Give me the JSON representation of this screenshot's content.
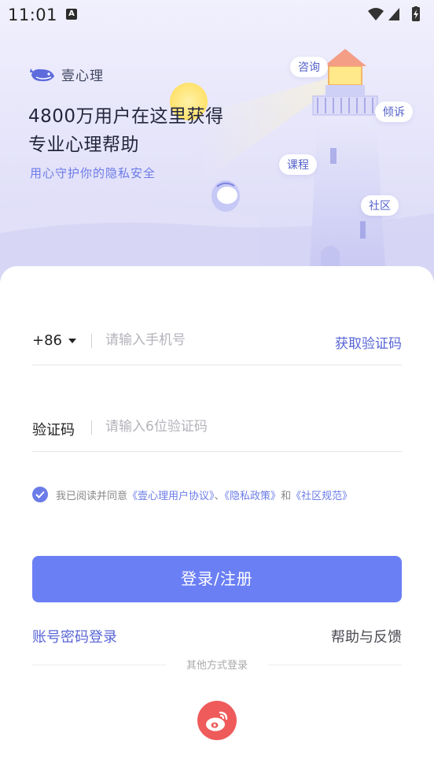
{
  "status_bar": {
    "time": "11:01",
    "notification_glyph": "A"
  },
  "brand": {
    "name": "壹心理",
    "logo_icon": "whale-logo-icon"
  },
  "hero": {
    "headline_line1": "4800万用户在这里获得",
    "headline_line2": "专业心理帮助",
    "subtitle": "用心守护你的隐私安全",
    "tags": [
      "咨询",
      "倾诉",
      "课程",
      "社区"
    ]
  },
  "form": {
    "country_code": "+86",
    "phone_placeholder": "请输入手机号",
    "get_code_label": "获取验证码",
    "code_label": "验证码",
    "code_placeholder": "请输入6位验证码"
  },
  "agreement": {
    "checked": true,
    "prefix": "我已阅读并同意",
    "user_agreement": "《壹心理用户协议》",
    "separator": "、",
    "privacy": "《隐私政策》",
    "and": "和",
    "community": "《社区规范》"
  },
  "actions": {
    "login_label": "登录/注册",
    "password_login": "账号密码登录",
    "help_feedback": "帮助与反馈",
    "other_methods": "其他方式登录"
  },
  "colors": {
    "accent": "#6b7ff5",
    "link": "#5865d6",
    "weibo": "#ef5b5b"
  }
}
